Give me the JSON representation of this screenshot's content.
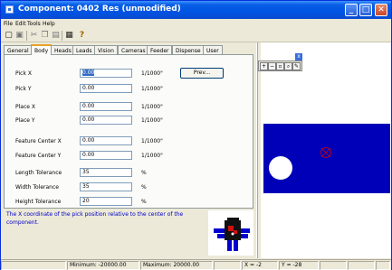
{
  "window": {
    "title": "Component: 0402 Res (unmodified)"
  },
  "menu": [
    "File",
    "Edit",
    "Tools",
    "Help"
  ],
  "toolbar": {
    "icons": [
      "new-icon",
      "save-icon",
      "cut-icon",
      "copy-icon",
      "paste-icon",
      "print-icon",
      "help-icon"
    ],
    "help_label": "?"
  },
  "tabs": [
    {
      "label": "General"
    },
    {
      "label": "Body"
    },
    {
      "label": "Heads"
    },
    {
      "label": "Leads"
    },
    {
      "label": "Vision"
    },
    {
      "label": "Cameras"
    },
    {
      "label": "Feeder"
    },
    {
      "label": "Dispense"
    },
    {
      "label": "User"
    }
  ],
  "active_tab": "Body",
  "form": {
    "pick_x": {
      "label": "Pick X",
      "value": "0.00",
      "unit": "1/1000\""
    },
    "pick_y": {
      "label": "Pick Y",
      "value": "0.00",
      "unit": "1/1000\""
    },
    "place_x": {
      "label": "Place X",
      "value": "0.00",
      "unit": "1/1000\""
    },
    "place_y": {
      "label": "Place Y",
      "value": "0.00",
      "unit": "1/1000\""
    },
    "feature_x": {
      "label": "Feature Center X",
      "value": "0.00",
      "unit": "1/1000\""
    },
    "feature_y": {
      "label": "Feature Center Y",
      "value": "0.00",
      "unit": "1/1000\""
    },
    "length_tol": {
      "label": "Length Tolerance",
      "value": "35",
      "unit": "%"
    },
    "width_tol": {
      "label": "Width Tolerance",
      "value": "35",
      "unit": "%"
    },
    "height_tol": {
      "label": "Height Tolerance",
      "value": "20",
      "unit": "%"
    },
    "prev_button": "Prev..."
  },
  "description": "The X coordinate of the pick position relative to the center of the component.",
  "view": {
    "close_label": "x",
    "tools": [
      "zoom-in-icon",
      "zoom-out-icon",
      "zoom-fit-icon",
      "zoom-window-icon",
      "pan-icon"
    ]
  },
  "status": {
    "minimum": "Minimum: -20000.00",
    "maximum": "Maximum: 20000.00",
    "x": "X = -2",
    "y": "Y = -28"
  },
  "colors": {
    "title_bar": "#0054e3",
    "view_background": "#0000b8",
    "description_text": "#0000c8",
    "selection": "#316ac5"
  }
}
